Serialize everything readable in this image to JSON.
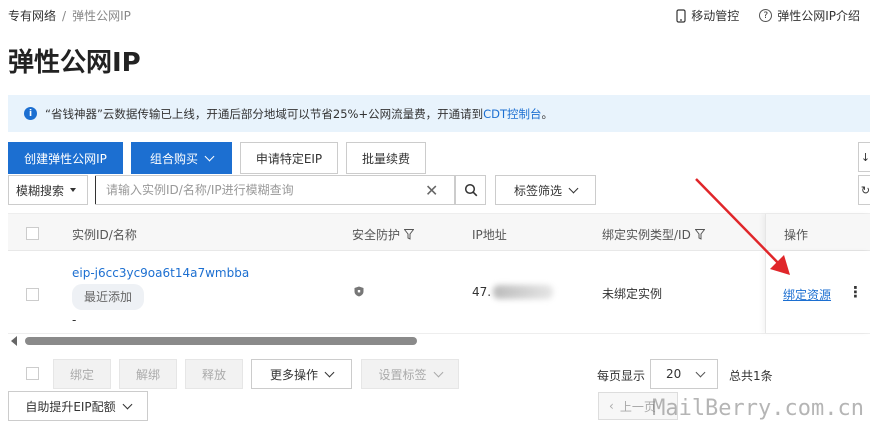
{
  "breadcrumb": {
    "root": "专有网络",
    "sep": "/",
    "current": "弹性公网IP"
  },
  "top_links": {
    "mobile": "移动管控",
    "intro": "弹性公网IP介绍"
  },
  "page_title": "弹性公网IP",
  "notice": {
    "text_before": "“省钱神器”云数据传输已上线，开通后部分地域可以节省25%+公网流量费，开通请到",
    "link": "CDT控制台",
    "text_after": "。"
  },
  "toolbar": {
    "create": "创建弹性公网IP",
    "combo_buy": "组合购买",
    "apply_eip": "申请特定EIP",
    "batch_renew": "批量续费"
  },
  "search": {
    "mode": "模糊搜索",
    "placeholder": "请输入实例ID/名称/IP进行模糊查询",
    "value": "",
    "tag_filter": "标签筛选"
  },
  "table": {
    "headers": {
      "instance": "实例ID/名称",
      "protection": "安全防护",
      "ip": "IP地址",
      "bind_type": "绑定实例类型/ID",
      "ops": "操作"
    },
    "rows": [
      {
        "instance_id": "eip-j6cc3yc9oa6t14a7wmbba",
        "tag": "最近添加",
        "name": "-",
        "ip_prefix": "47.",
        "bind": "未绑定实例",
        "op": "绑定资源",
        "more": "⋮"
      }
    ]
  },
  "bottom_actions": {
    "bind": "绑定",
    "unbind": "解绑",
    "release": "释放",
    "more_ops": "更多操作",
    "set_tags": "设置标签",
    "quota": "自助提升EIP配额"
  },
  "pagination": {
    "per_page_label": "每页显示",
    "per_page": "20",
    "total": "总共1条",
    "prev": "上一页"
  },
  "watermark": "MailBerry.com.cn",
  "colors": {
    "primary": "#1c6fd1",
    "notice_bg": "#e8f3fc",
    "arrow": "#e0262a"
  }
}
